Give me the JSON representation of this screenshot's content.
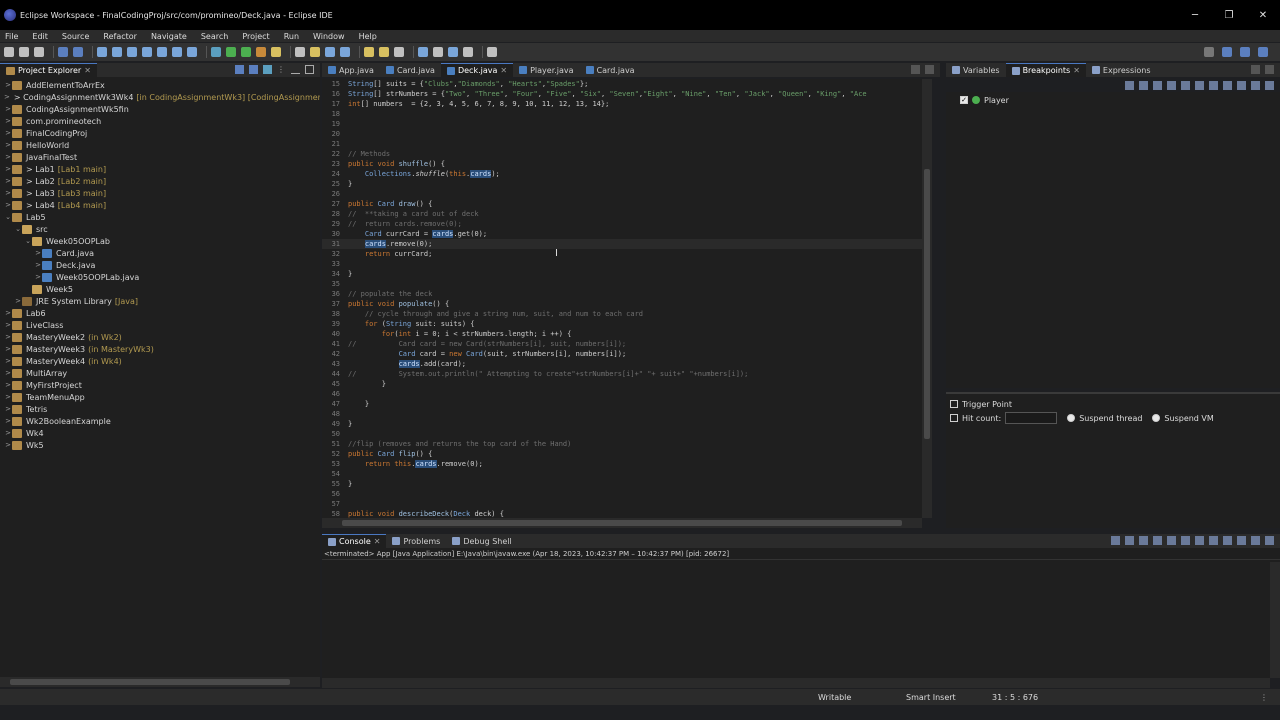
{
  "window": {
    "title": "Eclipse Workspace - FinalCodingProj/src/com/promineo/Deck.java - Eclipse IDE",
    "minimize": "─",
    "maximize": "❐",
    "close": "✕"
  },
  "menu": [
    "File",
    "Edit",
    "Source",
    "Refactor",
    "Navigate",
    "Search",
    "Project",
    "Run",
    "Window",
    "Help"
  ],
  "explorer": {
    "tab_label": "Project Explorer",
    "items": [
      {
        "label": "AddElementToArrEx",
        "sub": "",
        "arrow": ">",
        "indent": 0,
        "icon": "project"
      },
      {
        "label": "> CodingAssignmentWk3Wk4",
        "sub": "[in CodingAssignmentWk3] [CodingAssignmentWk",
        "arrow": ">",
        "indent": 0,
        "icon": "project"
      },
      {
        "label": "CodingAssignmentWk5fin",
        "sub": "",
        "arrow": ">",
        "indent": 0,
        "icon": "project"
      },
      {
        "label": "com.promineotech",
        "sub": "",
        "arrow": ">",
        "indent": 0,
        "icon": "project"
      },
      {
        "label": "FinalCodingProj",
        "sub": "",
        "arrow": ">",
        "indent": 0,
        "icon": "project"
      },
      {
        "label": "HelloWorld",
        "sub": "",
        "arrow": ">",
        "indent": 0,
        "icon": "project"
      },
      {
        "label": "JavaFinalTest",
        "sub": "",
        "arrow": ">",
        "indent": 0,
        "icon": "project"
      },
      {
        "label": "> Lab1",
        "sub": "[Lab1 main]",
        "arrow": ">",
        "indent": 0,
        "icon": "project"
      },
      {
        "label": "> Lab2",
        "sub": "[Lab2 main]",
        "arrow": ">",
        "indent": 0,
        "icon": "project"
      },
      {
        "label": "> Lab3",
        "sub": "[Lab3 main]",
        "arrow": ">",
        "indent": 0,
        "icon": "project"
      },
      {
        "label": "> Lab4",
        "sub": "[Lab4 main]",
        "arrow": ">",
        "indent": 0,
        "icon": "project"
      },
      {
        "label": "Lab5",
        "sub": "",
        "arrow": "⌄",
        "indent": 0,
        "icon": "project"
      },
      {
        "label": "src",
        "sub": "",
        "arrow": "⌄",
        "indent": 1,
        "icon": "src"
      },
      {
        "label": "Week05OOPLab",
        "sub": "",
        "arrow": "⌄",
        "indent": 2,
        "icon": "src"
      },
      {
        "label": "Card.java",
        "sub": "",
        "arrow": ">",
        "indent": 3,
        "icon": "java"
      },
      {
        "label": "Deck.java",
        "sub": "",
        "arrow": ">",
        "indent": 3,
        "icon": "java"
      },
      {
        "label": "Week05OOPLab.java",
        "sub": "",
        "arrow": ">",
        "indent": 3,
        "icon": "java"
      },
      {
        "label": "Week5",
        "sub": "",
        "arrow": "",
        "indent": 2,
        "icon": "src"
      },
      {
        "label": "JRE System Library",
        "sub": "[Java]",
        "arrow": ">",
        "indent": 1,
        "icon": "lib"
      },
      {
        "label": "Lab6",
        "sub": "",
        "arrow": ">",
        "indent": 0,
        "icon": "project"
      },
      {
        "label": "LiveClass",
        "sub": "",
        "arrow": ">",
        "indent": 0,
        "icon": "project"
      },
      {
        "label": "MasteryWeek2",
        "sub": "(in Wk2)",
        "arrow": ">",
        "indent": 0,
        "icon": "project"
      },
      {
        "label": "MasteryWeek3",
        "sub": "(in MasteryWk3)",
        "arrow": ">",
        "indent": 0,
        "icon": "project"
      },
      {
        "label": "MasteryWeek4",
        "sub": "(in Wk4)",
        "arrow": ">",
        "indent": 0,
        "icon": "project"
      },
      {
        "label": "MultiArray",
        "sub": "",
        "arrow": ">",
        "indent": 0,
        "icon": "project"
      },
      {
        "label": "MyFirstProject",
        "sub": "",
        "arrow": ">",
        "indent": 0,
        "icon": "project"
      },
      {
        "label": "TeamMenuApp",
        "sub": "",
        "arrow": ">",
        "indent": 0,
        "icon": "project"
      },
      {
        "label": "Tetris",
        "sub": "",
        "arrow": ">",
        "indent": 0,
        "icon": "project"
      },
      {
        "label": "Wk2BooleanExample",
        "sub": "",
        "arrow": ">",
        "indent": 0,
        "icon": "project"
      },
      {
        "label": "Wk4",
        "sub": "",
        "arrow": ">",
        "indent": 0,
        "icon": "project"
      },
      {
        "label": "Wk5",
        "sub": "",
        "arrow": ">",
        "indent": 0,
        "icon": "project"
      }
    ]
  },
  "editor": {
    "tabs": [
      {
        "label": "App.java",
        "active": false
      },
      {
        "label": "Card.java",
        "active": false
      },
      {
        "label": "Deck.java",
        "active": true
      },
      {
        "label": "Player.java",
        "active": false
      },
      {
        "label": "Card.java",
        "active": false
      }
    ],
    "lines": [
      {
        "n": "15",
        "html": "<span class='kw2'>String</span>[] suits = {<span class='st'>\"Clubs\"</span>,<span class='st'>\"Diamonds\"</span>, <span class='st'>\"Hearts\"</span>,<span class='st'>\"Spades\"</span>};"
      },
      {
        "n": "16",
        "html": "<span class='kw2'>String</span>[] strNumbers = {<span class='st'>\"Two\"</span>, <span class='st'>\"Three\"</span>, <span class='st'>\"Four\"</span>, <span class='st'>\"Five\"</span>, <span class='st'>\"Six\"</span>, <span class='st'>\"Seven\"</span>,<span class='st'>\"Eight\"</span>, <span class='st'>\"Nine\"</span>, <span class='st'>\"Ten\"</span>, <span class='st'>\"Jack\"</span>, <span class='st'>\"Queen\"</span>, <span class='st'>\"King\"</span>, <span class='st'>\"Ace</span>"
      },
      {
        "n": "17",
        "html": "<span class='kw'>int</span>[] numbers  = {2, 3, 4, 5, 6, 7, 8, 9, 10, 11, 12, 13, 14};"
      },
      {
        "n": "18",
        "html": ""
      },
      {
        "n": "19",
        "html": ""
      },
      {
        "n": "20",
        "html": ""
      },
      {
        "n": "21",
        "html": ""
      },
      {
        "n": "22",
        "html": "<span class='cm'>// Methods</span>"
      },
      {
        "n": "23",
        "html": "<span class='kw'>public void</span> <span class='nm'>shuffle</span>() {"
      },
      {
        "n": "24",
        "html": "    <span class='kw2'>Collections</span>.<i>shuffle</i>(<span class='kw'>this</span>.<span class='hl'>cards</span>);"
      },
      {
        "n": "25",
        "html": "}"
      },
      {
        "n": "26",
        "html": ""
      },
      {
        "n": "27",
        "html": "<span class='kw'>public</span> <span class='kw2'>Card</span> <span class='nm'>draw</span>() {"
      },
      {
        "n": "28",
        "html": "<span class='cm'>//  **taking a card out of deck</span>"
      },
      {
        "n": "29",
        "html": "<span class='cm'>//  return cards.remove(0);</span>"
      },
      {
        "n": "30",
        "html": "    <span class='kw2'>Card</span> currCard = <span class='hl'>cards</span>.get(0);"
      },
      {
        "n": "31",
        "html": "    <span class='hl'>cards</span>.remove(0);"
      },
      {
        "n": "32",
        "html": "    <span class='kw'>return</span> currCard;"
      },
      {
        "n": "33",
        "html": ""
      },
      {
        "n": "34",
        "html": "}"
      },
      {
        "n": "35",
        "html": ""
      },
      {
        "n": "36",
        "html": "<span class='cm'>// populate the deck</span>"
      },
      {
        "n": "37",
        "html": "<span class='kw'>public void</span> <span class='nm'>populate</span>() {"
      },
      {
        "n": "38",
        "html": "    <span class='cm'>// cycle through and give a string num, suit, and num to each card</span>"
      },
      {
        "n": "39",
        "html": "    <span class='kw'>for</span> (<span class='kw2'>String</span> suit: suits) {"
      },
      {
        "n": "40",
        "html": "        <span class='kw'>for</span>(<span class='kw'>int</span> i = 0; i &lt; strNumbers.length; i ++) {"
      },
      {
        "n": "41",
        "html": "<span class='cm'>//          Card card = new Card(strNumbers[i], suit, numbers[i]);</span>"
      },
      {
        "n": "42",
        "html": "            <span class='kw2'>Card</span> card = <span class='kw'>new</span> <span class='kw2'>Card</span>(suit, strNumbers[i], numbers[i]);"
      },
      {
        "n": "43",
        "html": "            <span class='hl'>cards</span>.add(card);"
      },
      {
        "n": "44",
        "html": "<span class='cm'>//          System.out.println(\" Attempting to create\"+strNumbers[i]+\" \"+ suit+\" \"+numbers[i]);</span>"
      },
      {
        "n": "45",
        "html": "        }"
      },
      {
        "n": "46",
        "html": ""
      },
      {
        "n": "47",
        "html": "    }"
      },
      {
        "n": "48",
        "html": ""
      },
      {
        "n": "49",
        "html": "}"
      },
      {
        "n": "50",
        "html": ""
      },
      {
        "n": "51",
        "html": "<span class='cm'>//flip (removes and returns the top card of the Hand)</span>"
      },
      {
        "n": "52",
        "html": "<span class='kw'>public</span> <span class='kw2'>Card</span> <span class='nm'>flip</span>() {"
      },
      {
        "n": "53",
        "html": "    <span class='kw'>return this</span>.<span class='hl'>cards</span>.remove(0);"
      },
      {
        "n": "54",
        "html": ""
      },
      {
        "n": "55",
        "html": "}"
      },
      {
        "n": "56",
        "html": ""
      },
      {
        "n": "57",
        "html": ""
      },
      {
        "n": "58",
        "html": "<span class='kw'>public void</span> <span class='nm'>describeDeck</span>(<span class='kw2'>Deck</span> deck) {"
      }
    ]
  },
  "right_panel": {
    "tabs": [
      {
        "label": "Variables",
        "active": false
      },
      {
        "label": "Breakpoints",
        "active": true
      },
      {
        "label": "Expressions",
        "active": false
      }
    ],
    "breakpoints": [
      {
        "label": "Player",
        "checked": true
      }
    ],
    "trigger_point_label": "Trigger Point",
    "hit_count_label": "Hit count:",
    "suspend_thread_label": "Suspend thread",
    "suspend_vm_label": "Suspend VM"
  },
  "console": {
    "tabs": [
      {
        "label": "Console",
        "active": true
      },
      {
        "label": "Problems",
        "active": false
      },
      {
        "label": "Debug Shell",
        "active": false
      }
    ],
    "status_line": "<terminated> App [Java Application] E:\\Java\\bin\\javaw.exe  (Apr 18, 2023, 10:42:37 PM – 10:42:37 PM) [pid: 26672]"
  },
  "statusbar": {
    "mode": "Writable",
    "insert": "Smart Insert",
    "position": "31 : 5 : 676"
  }
}
